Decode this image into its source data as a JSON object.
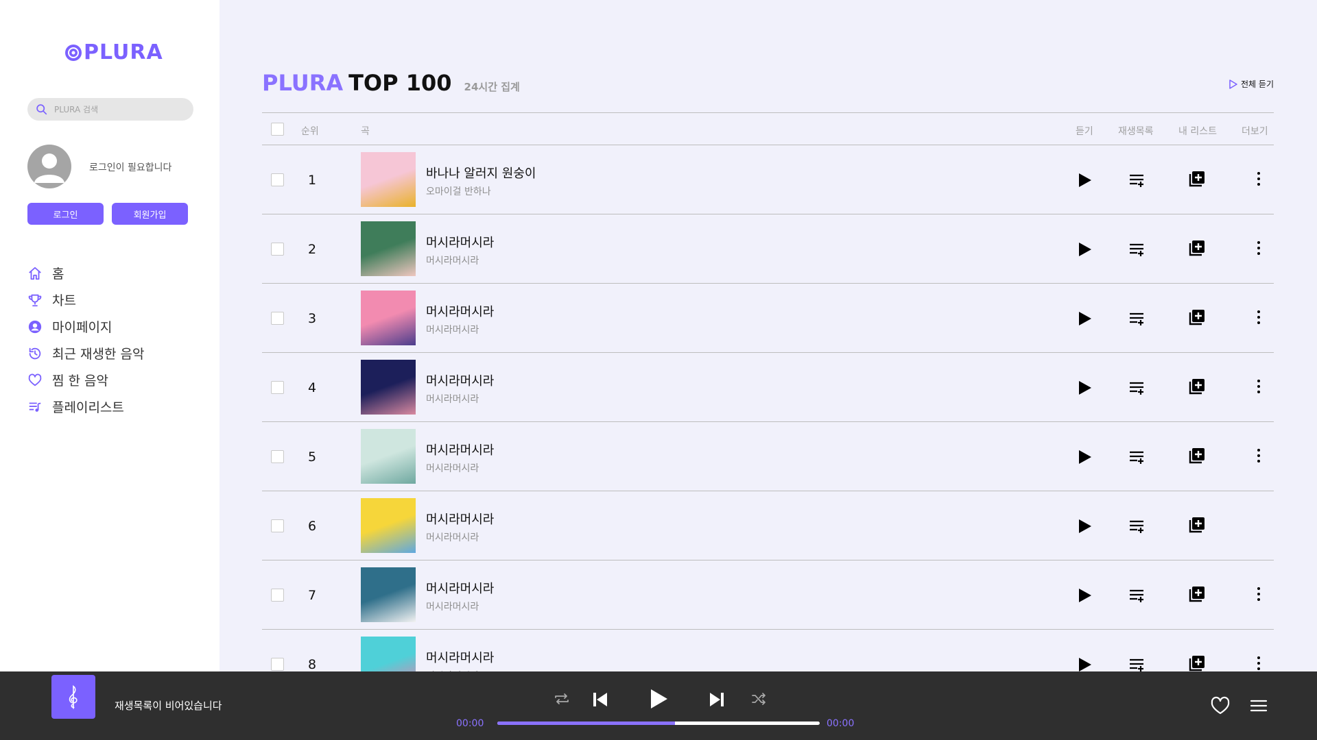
{
  "app": {
    "logo_text": "PLURA"
  },
  "search": {
    "placeholder": "PLURA 검색"
  },
  "user": {
    "login_message": "로그인이 필요합니다",
    "login_label": "로그인",
    "signup_label": "회원가입"
  },
  "nav": {
    "items": [
      {
        "label": "홈",
        "icon": "home-icon"
      },
      {
        "label": "차트",
        "icon": "trophy-icon"
      },
      {
        "label": "마이페이지",
        "icon": "user-circle-icon"
      },
      {
        "label": "최근 재생한 음악",
        "icon": "history-icon"
      },
      {
        "label": "찜 한 음악",
        "icon": "heart-icon"
      },
      {
        "label": "플레이리스트",
        "icon": "playlist-icon"
      }
    ]
  },
  "page": {
    "title_brand": "PLURA",
    "title_rest": "TOP 100",
    "subtitle": "24시간 집계",
    "play_all_label": "전체 듣기"
  },
  "table": {
    "headers": {
      "rank": "순위",
      "song": "곡",
      "listen": "듣기",
      "queue": "재생목록",
      "mylist": "내 리스트",
      "more": "더보기"
    },
    "rows": [
      {
        "rank": "1",
        "title": "바나나 알러지 원숭이",
        "artist": "오마이걸 반하나",
        "cover": [
          "#f6c6d6",
          "#e9b22a"
        ]
      },
      {
        "rank": "2",
        "title": "머시라머시라",
        "artist": "머시라머시라",
        "cover": [
          "#3f7d5a",
          "#f0c7c0"
        ]
      },
      {
        "rank": "3",
        "title": "머시라머시라",
        "artist": "머시라머시라",
        "cover": [
          "#f28bb0",
          "#4b3d8c"
        ]
      },
      {
        "rank": "4",
        "title": "머시라머시라",
        "artist": "머시라머시라",
        "cover": [
          "#1c1f5a",
          "#d98aa0"
        ]
      },
      {
        "rank": "5",
        "title": "머시라머시라",
        "artist": "머시라머시라",
        "cover": [
          "#cfe6df",
          "#6fa8a0"
        ]
      },
      {
        "rank": "6",
        "title": "머시라머시라",
        "artist": "머시라머시라",
        "cover": [
          "#f6d63a",
          "#5fa8e0"
        ]
      },
      {
        "rank": "7",
        "title": "머시라머시라",
        "artist": "머시라머시라",
        "cover": [
          "#2f6f8a",
          "#f2f2f2"
        ]
      },
      {
        "rank": "8",
        "title": "머시라머시라",
        "artist": "머시라머시라",
        "cover": [
          "#4fd0d8",
          "#f07aa8"
        ]
      }
    ]
  },
  "player": {
    "message": "재생목록이 비어있습니다",
    "time_current": "00:00",
    "time_total": "00:00",
    "progress": 0.55
  },
  "colors": {
    "accent": "#7b61ff",
    "accent_light": "#8a72ff",
    "player_bg": "#2f2f2f",
    "main_bg": "#f1f1fb"
  }
}
